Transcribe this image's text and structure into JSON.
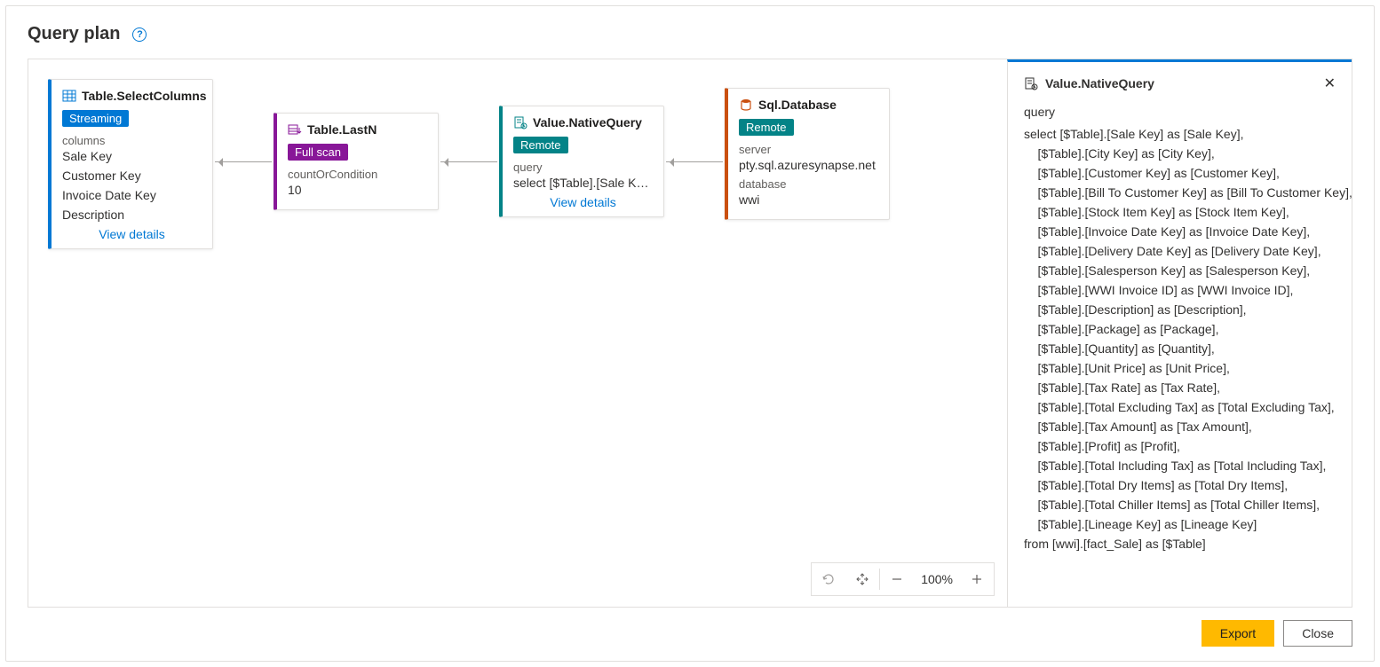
{
  "title": "Query plan",
  "nodes": {
    "selectColumns": {
      "title": "Table.SelectColumns",
      "badge": "Streaming",
      "fieldLabel": "columns",
      "vals": [
        "Sale Key",
        "Customer Key",
        "Invoice Date Key",
        "Description"
      ],
      "link": "View details"
    },
    "lastN": {
      "title": "Table.LastN",
      "badge": "Full scan",
      "fieldLabel": "countOrCondition",
      "val": "10"
    },
    "nativeQuery": {
      "title": "Value.NativeQuery",
      "badge": "Remote",
      "fieldLabel": "query",
      "val": "select [$Table].[Sale Ke…",
      "link": "View details"
    },
    "sqlDb": {
      "title": "Sql.Database",
      "badge": "Remote",
      "f1Label": "server",
      "f1Val": "pty.sql.azuresynapse.net",
      "f2Label": "database",
      "f2Val": "wwi"
    }
  },
  "zoom": "100%",
  "panel": {
    "title": "Value.NativeQuery",
    "label": "query",
    "sql": "select [$Table].[Sale Key] as [Sale Key],\n    [$Table].[City Key] as [City Key],\n    [$Table].[Customer Key] as [Customer Key],\n    [$Table].[Bill To Customer Key] as [Bill To Customer Key],\n    [$Table].[Stock Item Key] as [Stock Item Key],\n    [$Table].[Invoice Date Key] as [Invoice Date Key],\n    [$Table].[Delivery Date Key] as [Delivery Date Key],\n    [$Table].[Salesperson Key] as [Salesperson Key],\n    [$Table].[WWI Invoice ID] as [WWI Invoice ID],\n    [$Table].[Description] as [Description],\n    [$Table].[Package] as [Package],\n    [$Table].[Quantity] as [Quantity],\n    [$Table].[Unit Price] as [Unit Price],\n    [$Table].[Tax Rate] as [Tax Rate],\n    [$Table].[Total Excluding Tax] as [Total Excluding Tax],\n    [$Table].[Tax Amount] as [Tax Amount],\n    [$Table].[Profit] as [Profit],\n    [$Table].[Total Including Tax] as [Total Including Tax],\n    [$Table].[Total Dry Items] as [Total Dry Items],\n    [$Table].[Total Chiller Items] as [Total Chiller Items],\n    [$Table].[Lineage Key] as [Lineage Key]\nfrom [wwi].[fact_Sale] as [$Table]"
  },
  "buttons": {
    "export": "Export",
    "close": "Close"
  }
}
